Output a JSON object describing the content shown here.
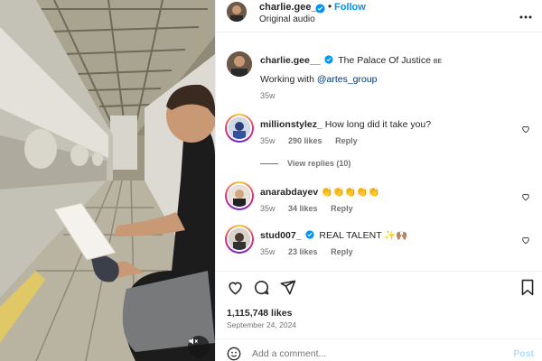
{
  "header": {
    "username": "charlie.gee__",
    "separator": "•",
    "follow_label": "Follow",
    "subtitle": "Original audio"
  },
  "caption": {
    "username": "charlie.gee__",
    "text_prefix": "The Palace Of Justice ",
    "text_suffix": "BE",
    "line2_prefix": "Working with ",
    "mention": "@artes_group",
    "time": "35w"
  },
  "comments": [
    {
      "username": "millionstylez_",
      "text": "How long did it take you?",
      "time": "35w",
      "likes": "290 likes",
      "reply_label": "Reply",
      "view_replies": "View replies (10)"
    },
    {
      "username": "anarabdayev",
      "text": "👏👏👏👏👏",
      "time": "35w",
      "likes": "34 likes",
      "reply_label": "Reply"
    },
    {
      "username": "stud007_",
      "text": "REAL TALENT ✨🙌🏽",
      "time": "35w",
      "likes": "23 likes",
      "reply_label": "Reply"
    }
  ],
  "footer": {
    "likes_count": "1,115,748 likes",
    "date": "September 24, 2024",
    "comment_placeholder": "Add a comment...",
    "post_label": "Post"
  },
  "icons": {
    "verified": "verified-badge-icon",
    "more": "more-options-icon",
    "heart": "heart-icon",
    "comment": "comment-icon",
    "share": "share-icon",
    "save": "bookmark-icon",
    "emoji": "emoji-icon",
    "mute": "muted-speaker-icon"
  },
  "colors": {
    "link_blue": "#0095f6",
    "mention_blue": "#00376b",
    "muted_text": "#737373",
    "post_disabled": "#b3dbff"
  }
}
